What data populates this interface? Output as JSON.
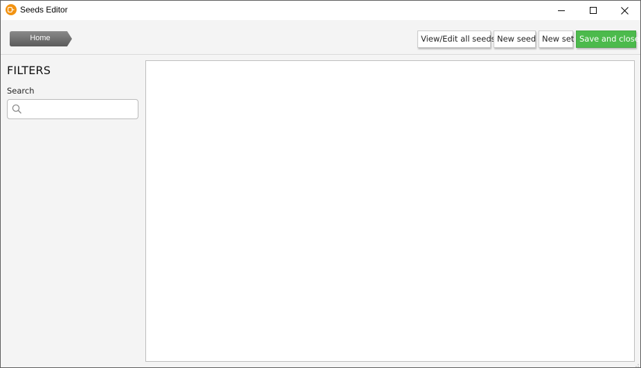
{
  "window": {
    "title": "Seeds Editor"
  },
  "icons": {
    "app": "seeds-app-icon",
    "minimize": "minimize-icon",
    "maximize": "maximize-icon",
    "close": "close-icon",
    "search": "search-icon",
    "resize": "resize-grip-icon"
  },
  "colors": {
    "app_icon": "#f29312",
    "save_button": "#4cba4c",
    "breadcrumb": "#6e6e6e"
  },
  "breadcrumb": {
    "home_label": "Home"
  },
  "toolbar": {
    "view_edit_label": "View/Edit all seeds",
    "new_seed_label": "New seed",
    "new_set_label": "New set",
    "save_close_label": "Save and close"
  },
  "sidebar": {
    "heading": "FILTERS",
    "search_label": "Search",
    "search_value": "",
    "search_placeholder": ""
  }
}
